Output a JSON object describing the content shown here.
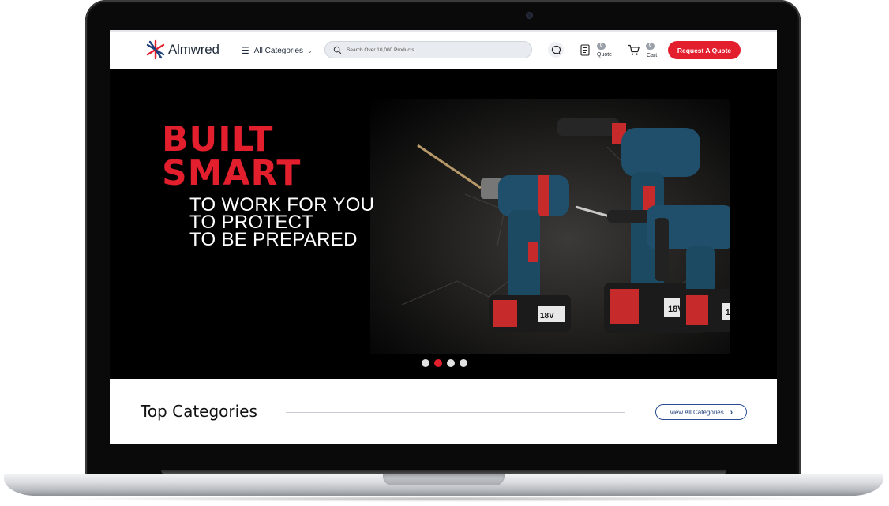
{
  "brand": {
    "name": "Almwred",
    "accent": "#e31e2d"
  },
  "header": {
    "all_categories": "All Categories",
    "search_placeholder": "Search Over 10,000 Products.",
    "quote": {
      "count": "0",
      "label": "Quote"
    },
    "cart": {
      "count": "0",
      "label": "Cart"
    },
    "request_quote": "Request A Quote"
  },
  "hero": {
    "title_line1": "BUILT",
    "title_line2": "SMART",
    "sub_lines": [
      "TO WORK FOR YOU",
      "TO PROTECT",
      "TO BE PREPARED"
    ],
    "battery_label": "18V",
    "slides_total": 4,
    "active_slide": 2
  },
  "categories": {
    "title": "Top Categories",
    "view_all": "View All Categories"
  }
}
